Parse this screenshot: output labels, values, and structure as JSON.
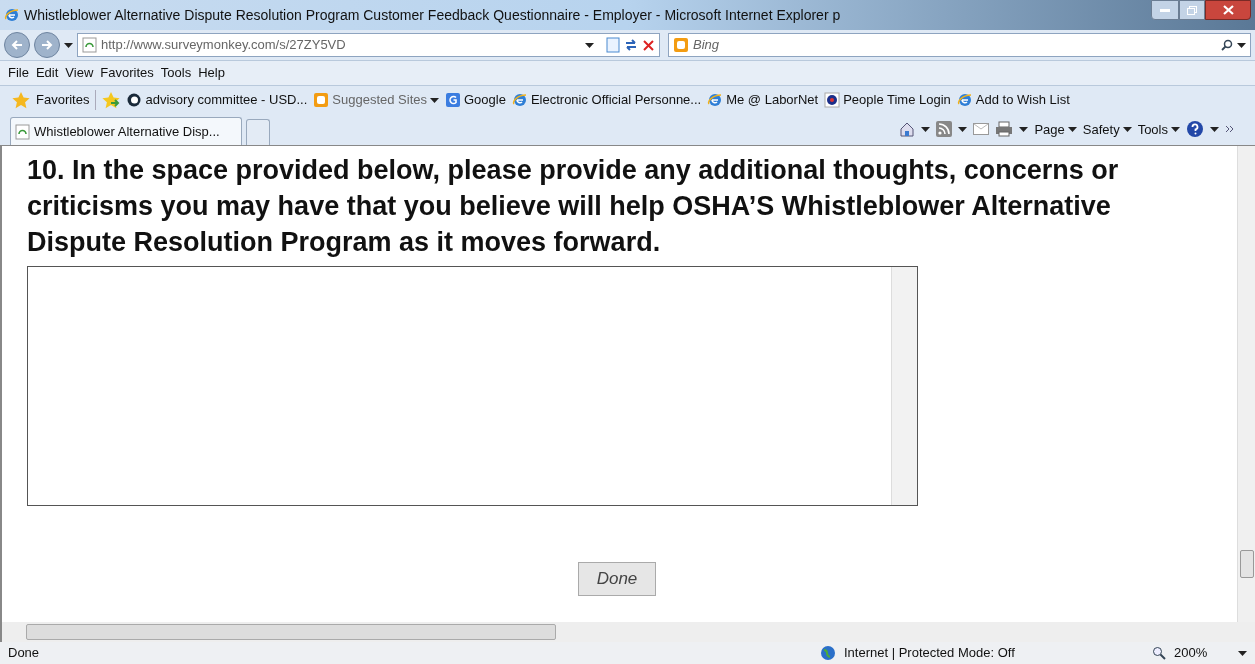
{
  "window": {
    "title": "Whistleblower Alternative Dispute Resolution Program Customer Feedback Questionnaire - Employer - Microsoft Internet Explorer p"
  },
  "address_bar": {
    "url": "http://www.surveymonkey.com/s/27ZY5VD"
  },
  "search": {
    "placeholder": "Bing"
  },
  "menu": [
    "File",
    "Edit",
    "View",
    "Favorites",
    "Tools",
    "Help"
  ],
  "favorites_bar": {
    "label": "Favorites",
    "items": [
      {
        "kind": "circle",
        "label": "advisory committee - USD...",
        "dropdown": false
      },
      {
        "kind": "bing",
        "label": "Suggested Sites",
        "dropdown": true
      },
      {
        "kind": "google",
        "label": "Google",
        "dropdown": false
      },
      {
        "kind": "ie",
        "label": "Electronic Official Personne...",
        "dropdown": false
      },
      {
        "kind": "ie",
        "label": "Me @ LaborNet",
        "dropdown": false
      },
      {
        "kind": "seal",
        "label": "People Time Login",
        "dropdown": false
      },
      {
        "kind": "ie",
        "label": "Add to Wish List",
        "dropdown": false
      }
    ]
  },
  "tabs": [
    {
      "label": "Whistleblower Alternative Disp...",
      "selected": true
    }
  ],
  "command_bar": [
    "Page",
    "Safety",
    "Tools"
  ],
  "question": {
    "text": "10. In the space provided below, please provide any additional thoughts, concerns or criticisms you may have that you believe will help OSHA’S Whistleblower Alternative Dispute Resolution Program as it moves forward."
  },
  "done_button": "Done",
  "status_bar": {
    "text": "Done",
    "zone": "Internet | Protected Mode: Off",
    "zoom": "200%"
  }
}
